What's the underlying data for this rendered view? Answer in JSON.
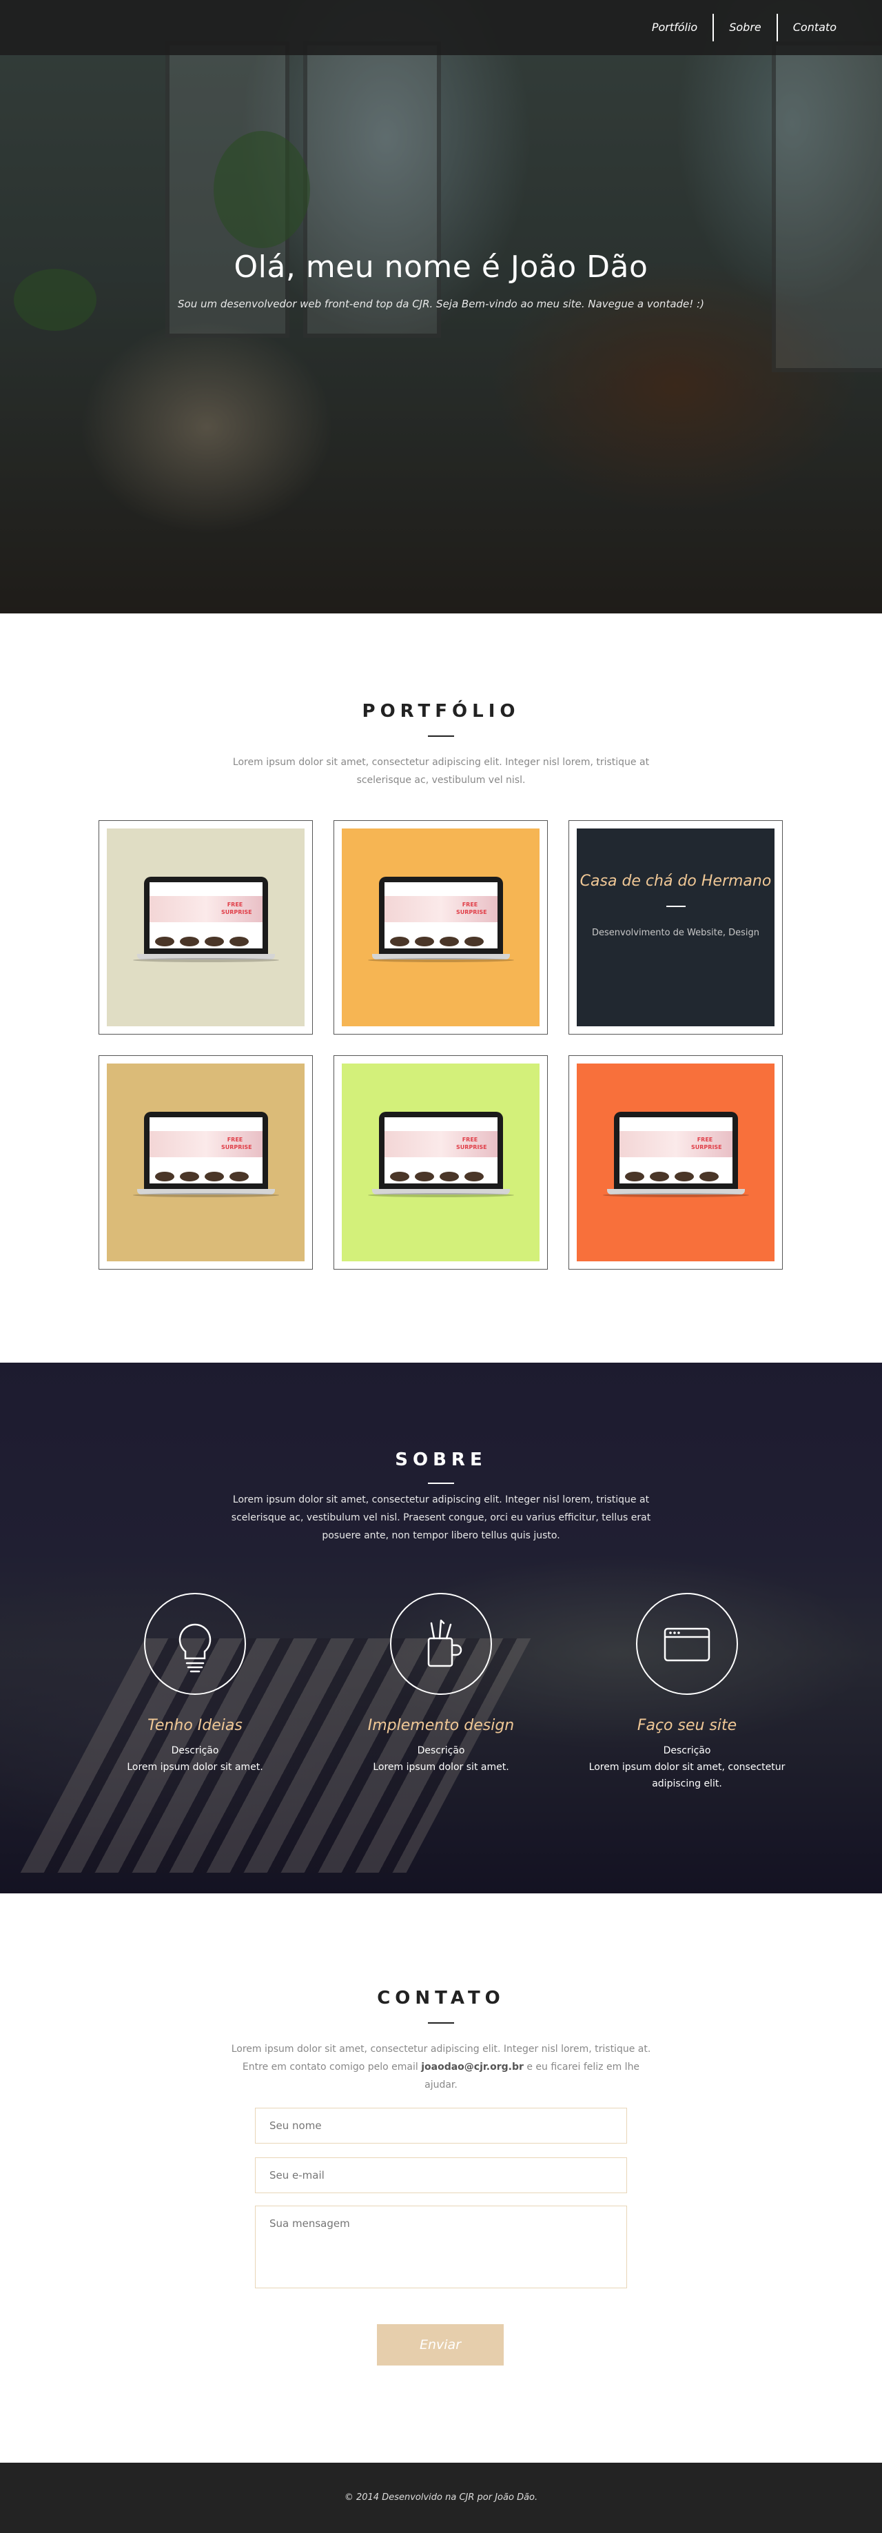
{
  "nav": {
    "items": [
      "Portfólio",
      "Sobre",
      "Contato"
    ]
  },
  "hero": {
    "title": "Olá, meu nome é João Dão",
    "subtitle": "Sou um desenvolvedor web front-end top da CJR. Seja Bem-vindo ao meu site. Navegue a vontade! :)"
  },
  "portfolio": {
    "title": "PORTFÓLIO",
    "lead": "Lorem ipsum dolor sit amet, consectetur adipiscing elit. Integer nisl lorem, tristique at scelerisque ac, vestibulum vel nisl.",
    "items": [
      {
        "bg": "#e0ddc4",
        "promo": "FREE SURPRISE"
      },
      {
        "bg": "#f6b553",
        "promo": "FREE SURPRISE"
      },
      {
        "bg": "#212830",
        "title": "Casa de chá do Hermano",
        "desc": "Desenvolvimento de Website, Design"
      },
      {
        "bg": "#dbbb78",
        "promo": "FREE SURPRISE"
      },
      {
        "bg": "#d3f07a",
        "promo": "FREE SURPRISE"
      },
      {
        "bg": "#f8703b",
        "promo": "FREE SURPRISE"
      }
    ]
  },
  "sobre": {
    "title": "SOBRE",
    "lead": "Lorem ipsum dolor sit amet, consectetur adipiscing elit. Integer nisl lorem, tristique at scelerisque ac, vestibulum vel nisl. Praesent congue, orci eu varius efficitur, tellus erat posuere ante, non tempor libero tellus quis justo.",
    "features": [
      {
        "icon": "lightbulb-icon",
        "title": "Tenho Ideias",
        "label": "Descrição",
        "desc": "Lorem ipsum dolor sit amet."
      },
      {
        "icon": "design-tools-icon",
        "title": "Implemento design",
        "label": "Descrição",
        "desc": "Lorem ipsum dolor sit amet."
      },
      {
        "icon": "browser-window-icon",
        "title": "Faço seu site",
        "label": "Descrição",
        "desc": "Lorem ipsum dolor sit amet, consectetur adipiscing elit."
      }
    ]
  },
  "contato": {
    "title": "CONTATO",
    "lead_1": "Lorem ipsum dolor sit amet, consectetur adipiscing elit. Integer nisl lorem, tristique at.",
    "lead_2_pre": "Entre em contato comigo pelo email ",
    "email": "joaodao@cjr.org.br",
    "lead_2_post": " e eu ficarei feliz em lhe ajudar.",
    "name_placeholder": "Seu nome",
    "email_placeholder": "Seu e-mail",
    "message_placeholder": "Sua mensagem",
    "submit": "Enviar"
  },
  "footer": {
    "text": "© 2014 Desenvolvido na CJR por João Dão."
  },
  "colors": {
    "accent": "#f0c896",
    "button": "#e6ceac",
    "dark": "#232323"
  }
}
